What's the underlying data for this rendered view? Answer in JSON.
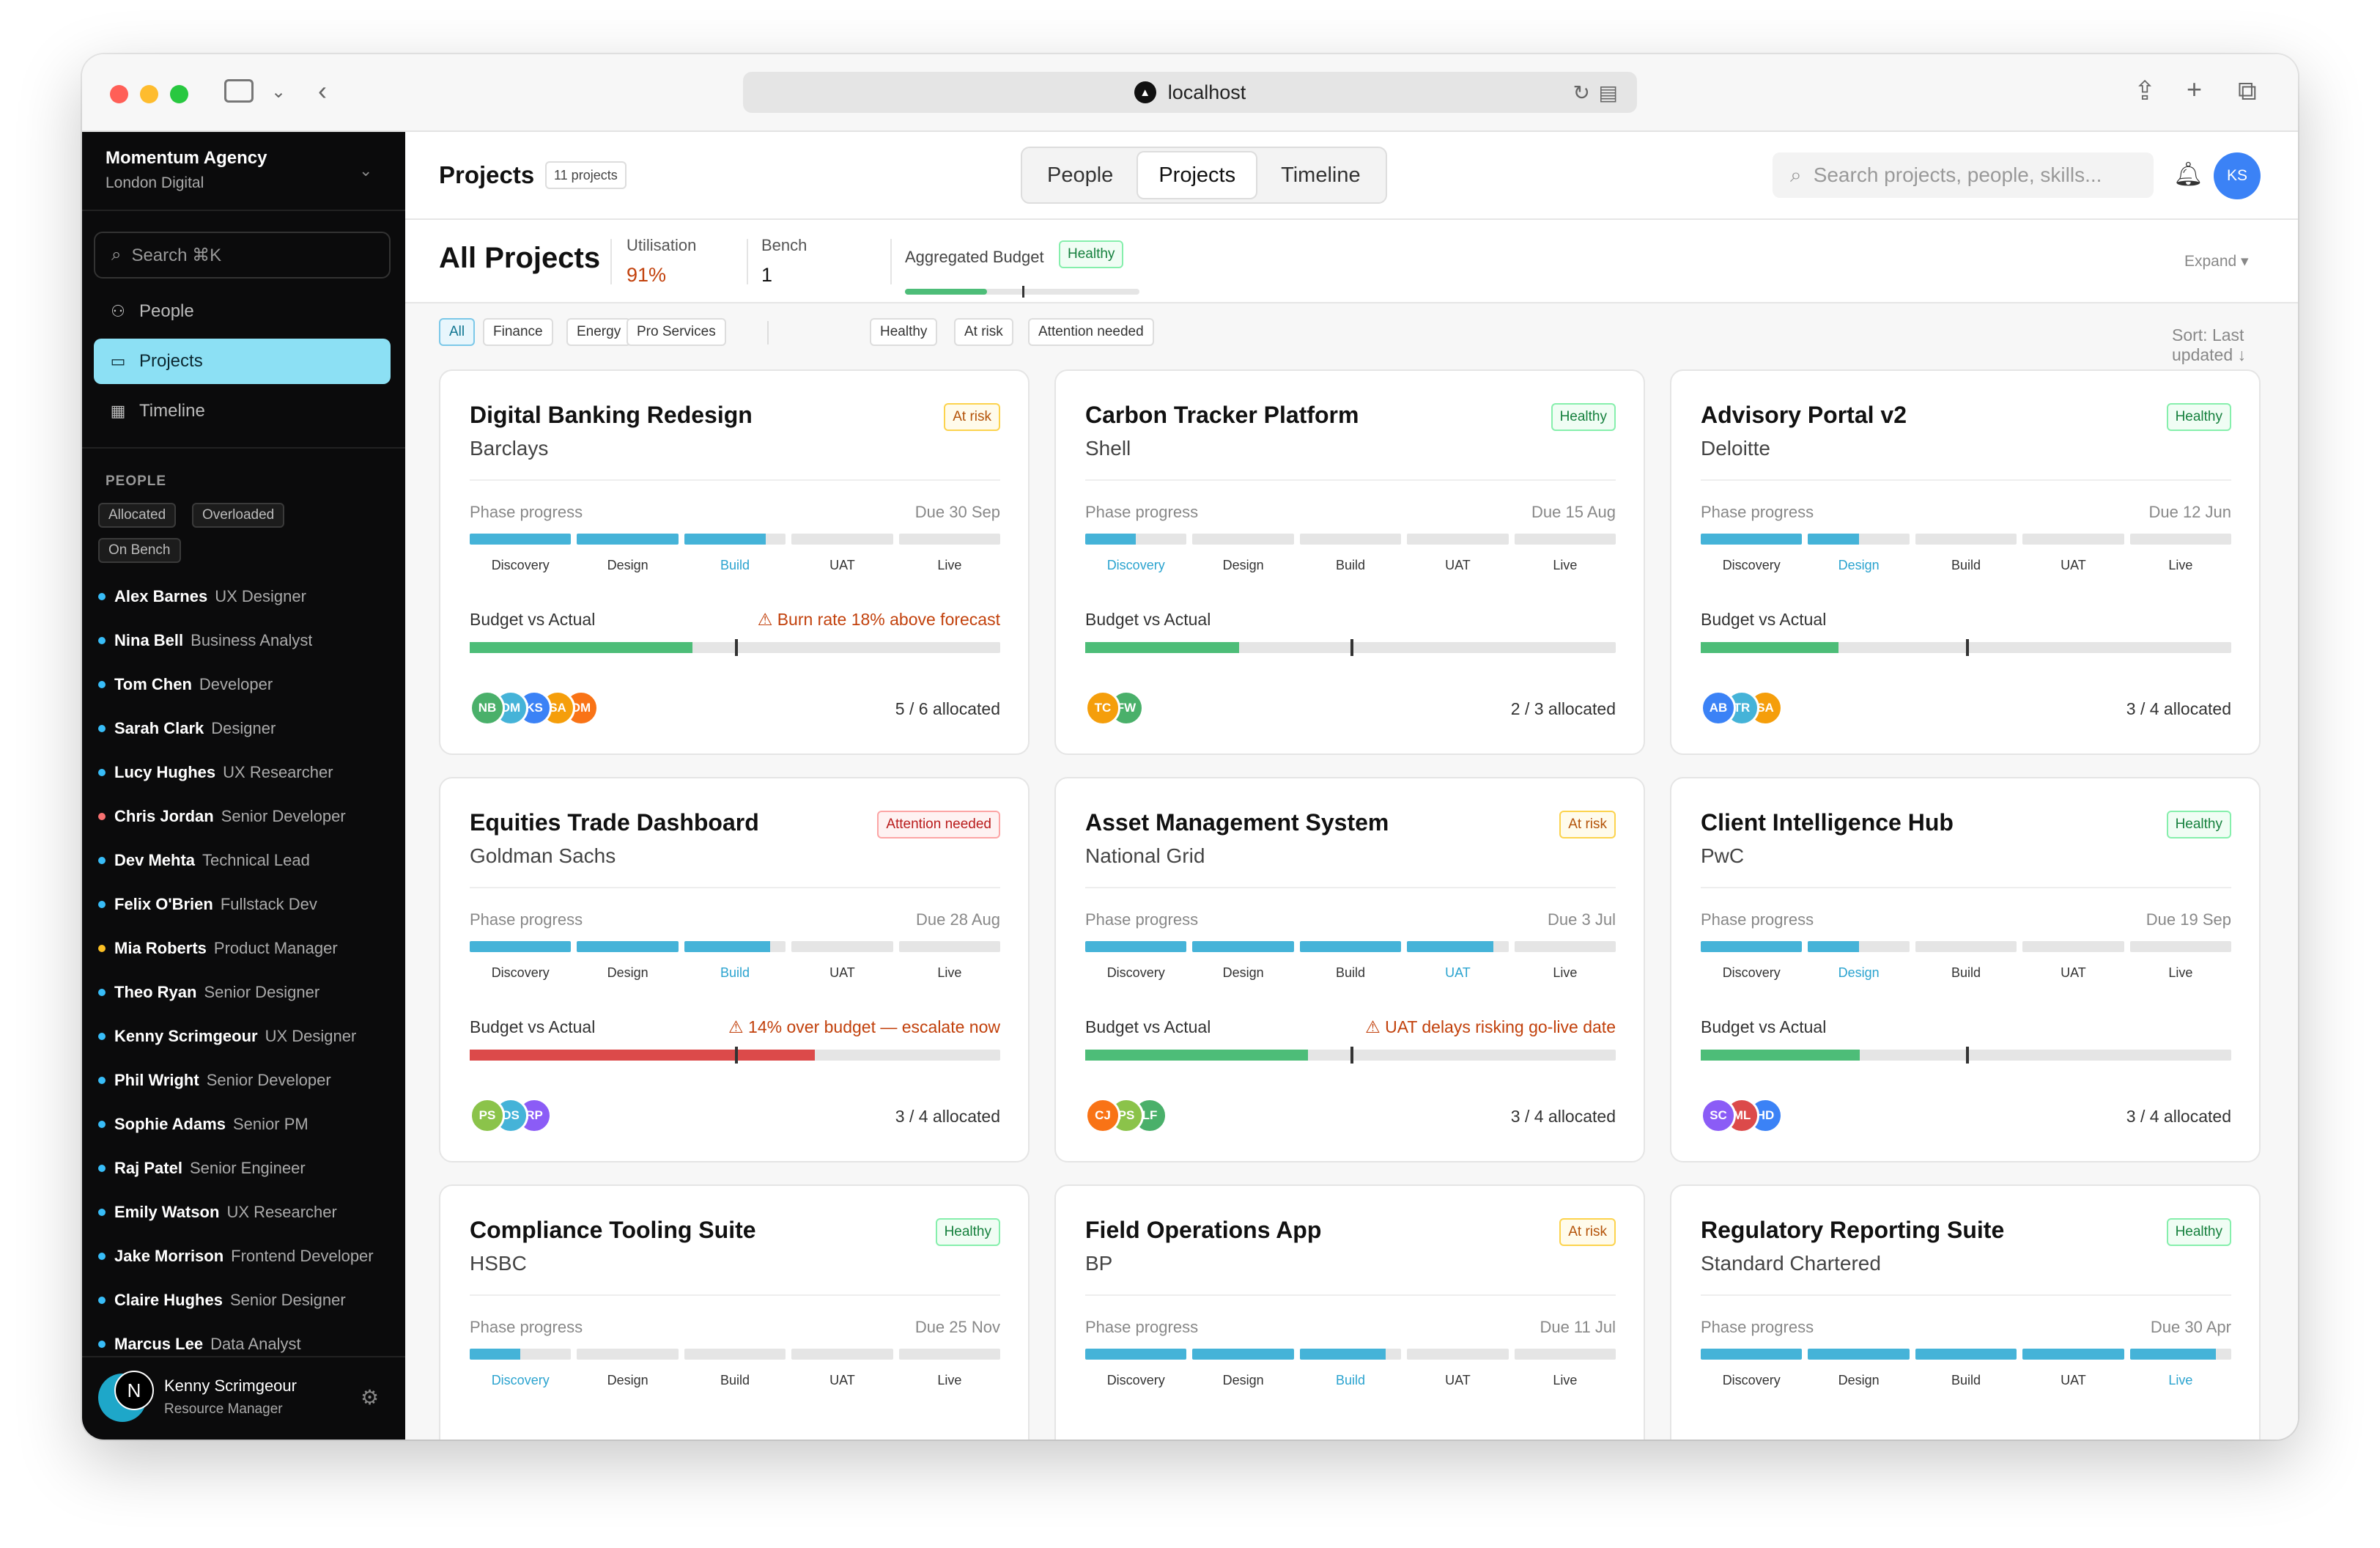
{
  "browser": {
    "url": "localhost"
  },
  "workspace": {
    "name": "Momentum Agency",
    "subtitle": "London Digital"
  },
  "sidebar": {
    "search_placeholder": "Search ⌘K",
    "nav": [
      {
        "label": "People"
      },
      {
        "label": "Projects"
      },
      {
        "label": "Timeline"
      }
    ],
    "people_heading": "PEOPLE",
    "people_filters": [
      "Allocated",
      "Overloaded",
      "On Bench"
    ],
    "people": [
      {
        "name": "Alex Barnes",
        "role": "UX Designer"
      },
      {
        "name": "Nina Bell",
        "role": "Business Analyst"
      },
      {
        "name": "Tom Chen",
        "role": "Developer"
      },
      {
        "name": "Sarah Clark",
        "role": "Designer"
      },
      {
        "name": "Lucy Hughes",
        "role": "UX Researcher"
      },
      {
        "name": "Chris Jordan",
        "role": "Senior Developer"
      },
      {
        "name": "Dev Mehta",
        "role": "Technical Lead"
      },
      {
        "name": "Felix O'Brien",
        "role": "Fullstack Dev"
      },
      {
        "name": "Mia Roberts",
        "role": "Product Manager"
      },
      {
        "name": "Theo Ryan",
        "role": "Senior Designer"
      },
      {
        "name": "Kenny Scrimgeour",
        "role": "UX Designer"
      },
      {
        "name": "Phil Wright",
        "role": "Senior Developer"
      },
      {
        "name": "Sophie Adams",
        "role": "Senior PM"
      },
      {
        "name": "Raj Patel",
        "role": "Senior Engineer"
      },
      {
        "name": "Emily Watson",
        "role": "UX Researcher"
      },
      {
        "name": "Jake Morrison",
        "role": "Frontend Developer"
      },
      {
        "name": "Claire Hughes",
        "role": "Senior Designer"
      },
      {
        "name": "Marcus Lee",
        "role": "Data Analyst"
      }
    ],
    "user": {
      "initial": "N",
      "name": "Kenny Scrimgeour",
      "role": "Resource Manager"
    }
  },
  "header": {
    "title": "Projects",
    "count": "11 projects",
    "tabs": [
      {
        "label": "People"
      },
      {
        "label": "Projects"
      },
      {
        "label": "Timeline"
      }
    ],
    "search_placeholder": "Search projects, people, skills...",
    "avatar": "KS"
  },
  "summary": {
    "title": "All Projects",
    "utilisation_label": "Utilisation",
    "utilisation_value": "91%",
    "bench_label": "Bench",
    "bench_value": "1",
    "budget_label": "Aggregated Budget",
    "budget_status": "Healthy",
    "budget_fill": 0.35,
    "budget_marker": 0.5,
    "expand": "Expand ▾"
  },
  "filters": {
    "chips": [
      "All",
      "Finance",
      "Energy",
      "Pro Services",
      "Healthy",
      "At risk",
      "Attention needed"
    ],
    "sort": "Sort: Last updated ↓"
  },
  "labels": {
    "phase_progress": "Phase progress",
    "budget_vs_actual": "Budget vs Actual",
    "phases": [
      "Discovery",
      "Design",
      "Build",
      "UAT",
      "Live"
    ]
  },
  "colors": {
    "accent": "#45b3d8",
    "healthy": "#15803d",
    "risk": "#b45309",
    "attention": "#b91c1c",
    "budget_green": "#4dbd78",
    "budget_red": "#dc4a4a"
  },
  "projects": [
    {
      "title": "Digital Banking Redesign",
      "client": "Barclays",
      "status": "At risk",
      "due": "Due 30 Sep",
      "phase_fill": [
        1,
        1,
        0.8,
        0,
        0
      ],
      "current": 2,
      "warning": "⚠ Burn rate 18% above forecast",
      "budget_fill": 0.42,
      "budget_marker": 0.5,
      "budget_color": "green",
      "avatars": [
        {
          "i": "NB",
          "c": "#4ab06a"
        },
        {
          "i": "DM",
          "c": "#45b3d8"
        },
        {
          "i": "KS",
          "c": "#3b82f6"
        },
        {
          "i": "SA",
          "c": "#f59e0b"
        },
        {
          "i": "DM",
          "c": "#f97316"
        }
      ],
      "allocated": "5 / 6 allocated"
    },
    {
      "title": "Carbon Tracker Platform",
      "client": "Shell",
      "status": "Healthy",
      "due": "Due 15 Aug",
      "phase_fill": [
        0.5,
        0,
        0,
        0,
        0
      ],
      "current": 0,
      "warning": "",
      "budget_fill": 0.29,
      "budget_marker": 0.5,
      "budget_color": "green",
      "avatars": [
        {
          "i": "TC",
          "c": "#f59e0b"
        },
        {
          "i": "FW",
          "c": "#4ab06a"
        }
      ],
      "allocated": "2 / 3 allocated"
    },
    {
      "title": "Advisory Portal v2",
      "client": "Deloitte",
      "status": "Healthy",
      "due": "Due 12 Jun",
      "phase_fill": [
        1,
        0.5,
        0,
        0,
        0
      ],
      "current": 1,
      "warning": "",
      "budget_fill": 0.26,
      "budget_marker": 0.5,
      "budget_color": "green",
      "avatars": [
        {
          "i": "AB",
          "c": "#3b82f6"
        },
        {
          "i": "TR",
          "c": "#45b3d8"
        },
        {
          "i": "SA",
          "c": "#f59e0b"
        }
      ],
      "allocated": "3 / 4 allocated"
    },
    {
      "title": "Equities Trade Dashboard",
      "client": "Goldman Sachs",
      "status": "Attention needed",
      "due": "Due 28 Aug",
      "phase_fill": [
        1,
        1,
        0.85,
        0,
        0
      ],
      "current": 2,
      "warning": "⚠ 14% over budget — escalate now",
      "budget_fill": 0.65,
      "budget_marker": 0.5,
      "budget_color": "red",
      "avatars": [
        {
          "i": "PS",
          "c": "#8bc34a"
        },
        {
          "i": "DS",
          "c": "#45b3d8"
        },
        {
          "i": "RP",
          "c": "#8b5cf6"
        }
      ],
      "allocated": "3 / 4 allocated"
    },
    {
      "title": "Asset Management System",
      "client": "National Grid",
      "status": "At risk",
      "due": "Due 3 Jul",
      "phase_fill": [
        1,
        1,
        1,
        0.85,
        0
      ],
      "current": 3,
      "warning": "⚠ UAT delays risking go-live date",
      "budget_fill": 0.42,
      "budget_marker": 0.5,
      "budget_color": "green",
      "avatars": [
        {
          "i": "CJ",
          "c": "#f97316"
        },
        {
          "i": "PS",
          "c": "#8bc34a"
        },
        {
          "i": "LF",
          "c": "#4ab06a"
        }
      ],
      "allocated": "3 / 4 allocated"
    },
    {
      "title": "Client Intelligence Hub",
      "client": "PwC",
      "status": "Healthy",
      "due": "Due 19 Sep",
      "phase_fill": [
        1,
        0.5,
        0,
        0,
        0
      ],
      "current": 1,
      "warning": "",
      "budget_fill": 0.3,
      "budget_marker": 0.5,
      "budget_color": "green",
      "avatars": [
        {
          "i": "SC",
          "c": "#8b5cf6"
        },
        {
          "i": "ML",
          "c": "#dc4a4a"
        },
        {
          "i": "HD",
          "c": "#3b82f6"
        }
      ],
      "allocated": "3 / 4 allocated"
    },
    {
      "title": "Compliance Tooling Suite",
      "client": "HSBC",
      "status": "Healthy",
      "due": "Due 25 Nov",
      "phase_fill": [
        0.5,
        0,
        0,
        0,
        0
      ],
      "current": 0
    },
    {
      "title": "Field Operations App",
      "client": "BP",
      "status": "At risk",
      "due": "Due 11 Jul",
      "phase_fill": [
        1,
        1,
        0.85,
        0,
        0
      ],
      "current": 2
    },
    {
      "title": "Regulatory Reporting Suite",
      "client": "Standard Chartered",
      "status": "Healthy",
      "due": "Due 30 Apr",
      "phase_fill": [
        1,
        1,
        1,
        1,
        0.85
      ],
      "current": 4
    }
  ]
}
